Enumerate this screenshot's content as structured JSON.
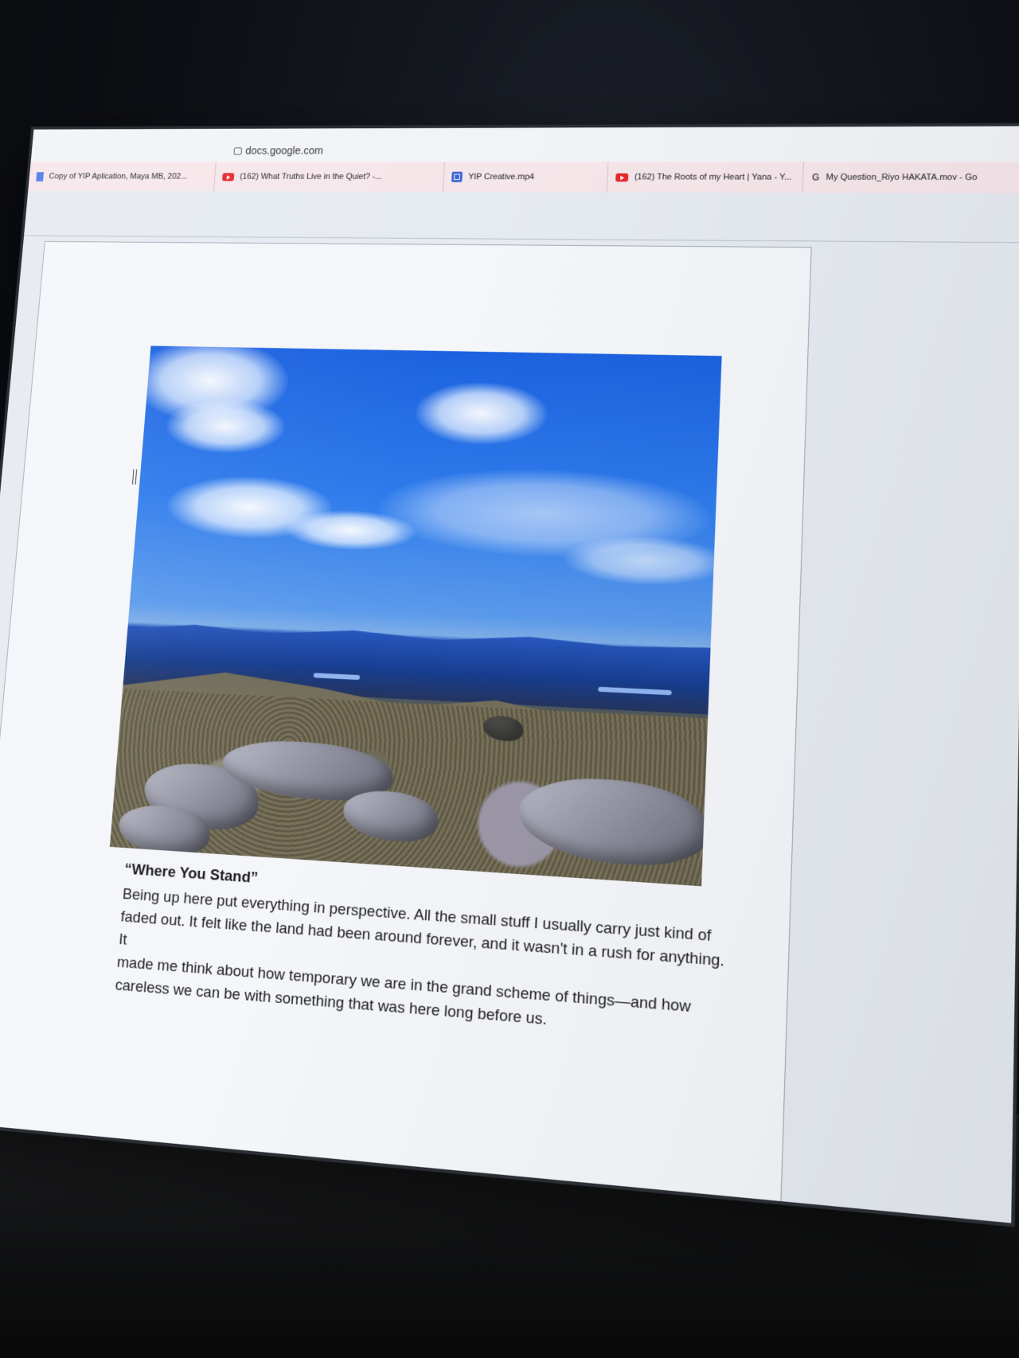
{
  "browser": {
    "url": "docs.google.com",
    "bookmarks": [
      {
        "label": "Copy of YIP Aplication, Maya MB, 202...",
        "icon": "doc-icon"
      },
      {
        "label": "(162) What Truths Live in the Quiet? -...",
        "icon": "youtube-icon"
      },
      {
        "label": "YIP Creative.mp4",
        "icon": "clip-icon"
      },
      {
        "label": "(162) The Roots of my Heart | Yana - Y...",
        "icon": "youtube-icon"
      },
      {
        "label": "My Question_Riyo HAKATA.mov - Go",
        "icon": "g-icon"
      }
    ]
  },
  "document": {
    "image": {
      "subject": "mountain summit landscape with blue sky and clouds"
    },
    "caption_title": "“Where You Stand”",
    "caption_lines": [
      "Being up here put everything in perspective. All the small stuff I usually carry just kind of",
      "faded out. It felt like the land had been around forever, and it wasn't in a rush for anything. It",
      "made me think about how temporary we are in the grand scheme of things—and how",
      "careless we can be with something that was here long before us."
    ]
  },
  "colors": {
    "bookmark_bar": "#f5e6ea",
    "page": "#f4f6fa",
    "sky": "#2f7cec",
    "youtube_red": "#e4262a"
  }
}
